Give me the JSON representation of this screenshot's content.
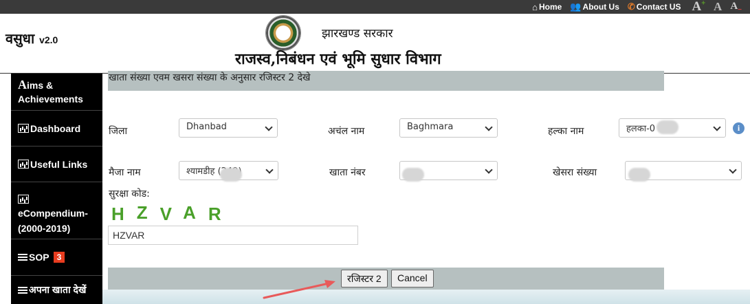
{
  "topbar": {
    "home_label": "Home",
    "about_label": "About Us",
    "contact_label": "Contact US",
    "font_increase": "A",
    "font_normal": "A",
    "font_decrease": "A",
    "plus_sign": "+",
    "minus_sign": "−"
  },
  "header": {
    "brand": "वसुधा",
    "version": "v2.0",
    "govt": "झारखण्ड सरकार",
    "department": "राजस्व,निबंधन एवं भूमि सुधार विभाग"
  },
  "sidebar": {
    "items": [
      {
        "label": "ims & Achievements",
        "lead": "A"
      },
      {
        "label": "Dashboard"
      },
      {
        "label": "Useful Links"
      },
      {
        "label": "eCompendium-(2000-2019)"
      },
      {
        "label": "SOP",
        "badge": "3"
      },
      {
        "label": "अपना खाता देखें"
      }
    ]
  },
  "form": {
    "title": "खाता संख्या एवम खसरा संख्या के अनुसार रजिस्टर 2 देखे",
    "district_label": "जिला",
    "district_value": "Dhanbad",
    "anchal_label": "अचंल नाम",
    "anchal_value": "Baghmara",
    "halka_label": "हल्का नाम",
    "halka_value": "हलका-0",
    "mauza_label": "मैजा नाम",
    "mauza_value": "श्यामडीह (249)",
    "khata_label": "खाता नंबर",
    "khata_value": "",
    "khesra_label": "खेसरा संख्या",
    "khesra_value": "",
    "captcha_label": "सुरक्षा कोड:",
    "captcha_chars": [
      "H",
      "Z",
      "V",
      "A",
      "R"
    ],
    "captcha_input": "HZVAR",
    "register_button": "रजिस्टर 2",
    "cancel_button": "Cancel"
  },
  "colors": {
    "topbar": "#3a3a3a",
    "sidebar": "#000000",
    "form_bar": "#b6c0c0",
    "badge": "#e83c1f",
    "captcha": "#4aa02a",
    "arrow": "#e85a5a"
  }
}
